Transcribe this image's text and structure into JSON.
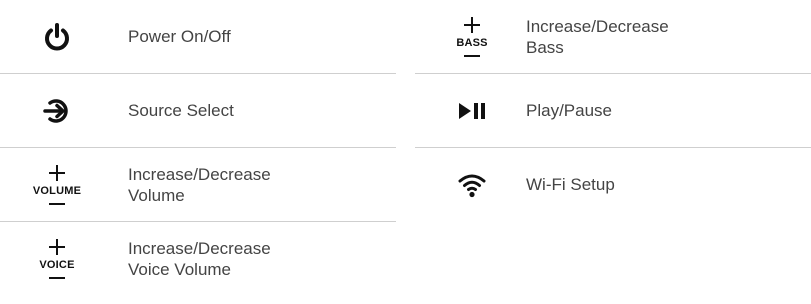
{
  "left_column": [
    {
      "icon": "power-icon",
      "label": "Power On/Off"
    },
    {
      "icon": "source-select-icon",
      "label": "Source Select"
    },
    {
      "icon": "volume-plus-minus-icon",
      "icon_text": "VOLUME",
      "label": "Increase/Decrease\nVolume"
    },
    {
      "icon": "voice-plus-minus-icon",
      "icon_text": "VOICE",
      "label": "Increase/Decrease\nVoice Volume"
    }
  ],
  "right_column": [
    {
      "icon": "bass-plus-minus-icon",
      "icon_text": "BASS",
      "label": "Increase/Decrease\nBass"
    },
    {
      "icon": "play-pause-icon",
      "label": "Play/Pause"
    },
    {
      "icon": "wifi-icon",
      "label": "Wi-Fi Setup"
    }
  ],
  "colors": {
    "icon": "#111111",
    "text": "#444444",
    "divider": "#cfcfcf"
  }
}
